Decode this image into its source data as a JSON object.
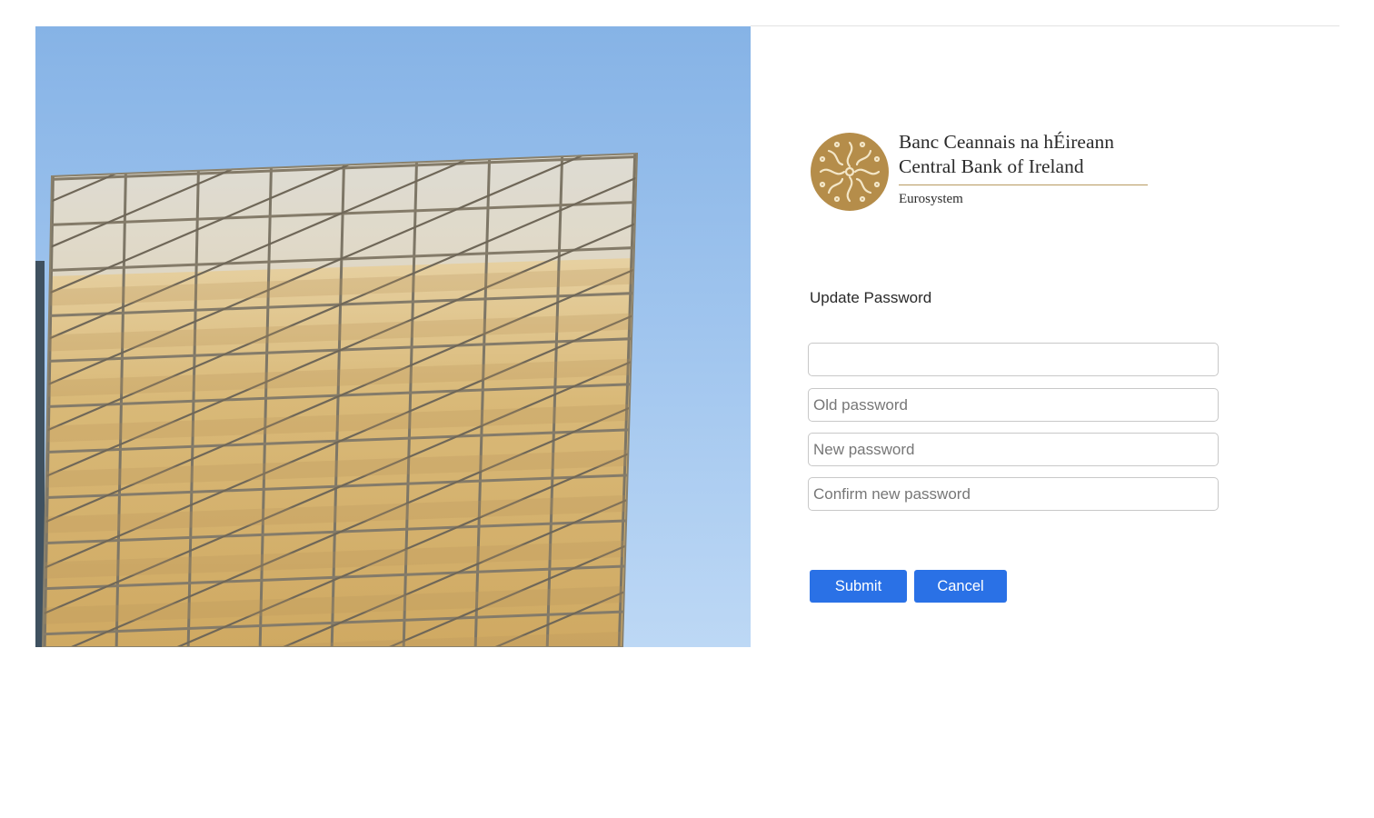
{
  "brand": {
    "name_irish": "Banc Ceannais na hÉireann",
    "name_english": "Central Bank of Ireland",
    "tagline": "Eurosystem",
    "gold": "#b58d4a"
  },
  "hero": {
    "icon": "building-facade-photo"
  },
  "form": {
    "title": "Update Password",
    "fields": [
      {
        "name": "username",
        "value": "",
        "placeholder": ""
      },
      {
        "name": "old_password",
        "value": "",
        "placeholder": "Old password"
      },
      {
        "name": "new_password",
        "value": "",
        "placeholder": "New password"
      },
      {
        "name": "confirm_password",
        "value": "",
        "placeholder": "Confirm new password"
      }
    ],
    "submit_label": "Submit",
    "cancel_label": "Cancel"
  },
  "colors": {
    "accent": "#2a71e6",
    "field_border": "#c8c8c8"
  }
}
